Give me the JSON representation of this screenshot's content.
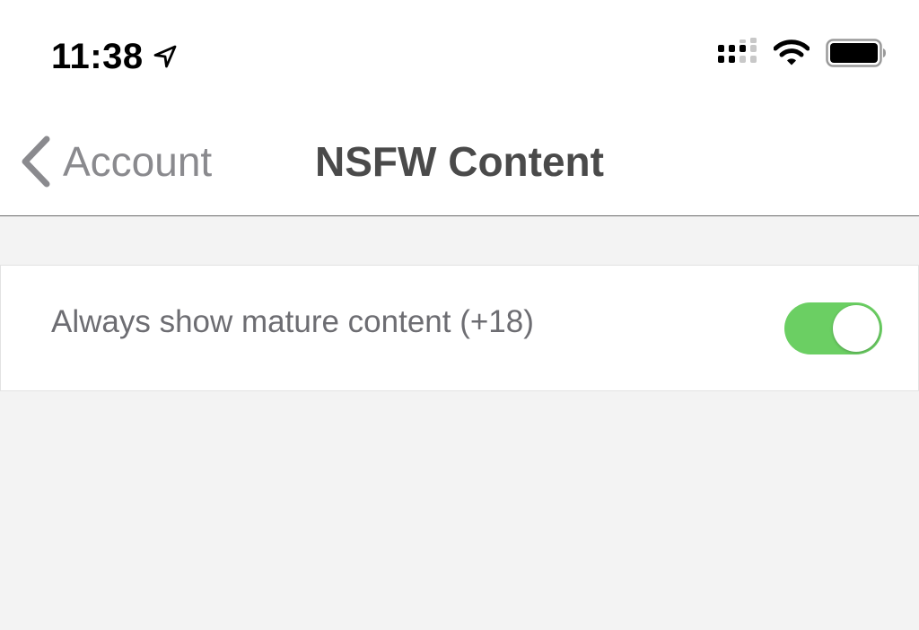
{
  "status_bar": {
    "time": "11:38",
    "icons": [
      "location-arrow-icon",
      "cellular-signal-icon",
      "wifi-icon",
      "battery-icon"
    ]
  },
  "nav": {
    "back_label": "Account",
    "title": "NSFW Content"
  },
  "settings": {
    "items": [
      {
        "label": "Always show mature content (+18)",
        "enabled": true
      }
    ]
  },
  "colors": {
    "toggle_on": "#6bcf63",
    "background": "#f3f3f3",
    "title_text": "#4a4a4a",
    "secondary_text": "#8a8a8e"
  }
}
